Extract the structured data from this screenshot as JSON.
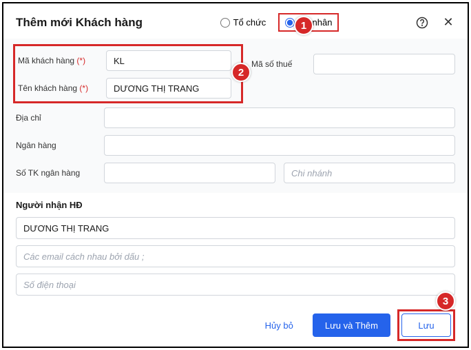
{
  "header": {
    "title": "Thêm mới Khách hàng",
    "radio_org": "Tổ chức",
    "radio_individual": "Cá nhân"
  },
  "form": {
    "customer_code_label": "Mã khách hàng",
    "customer_code_value": "KL",
    "tax_code_label": "Mã số thuế",
    "tax_code_value": "",
    "customer_name_label": "Tên khách hàng",
    "customer_name_value": "DƯƠNG THỊ TRANG",
    "address_label": "Địa chỉ",
    "address_value": "",
    "bank_label": "Ngân hàng",
    "bank_value": "",
    "bank_account_label": "Số TK ngân hàng",
    "bank_account_value": "",
    "branch_placeholder": "Chi nhánh",
    "required_mark": "(*)"
  },
  "recipient": {
    "section_title": "Người nhận HĐ",
    "name_value": "DƯƠNG THỊ TRANG",
    "email_placeholder": "Các email cách nhau bởi dấu ;",
    "phone_placeholder": "Số điện thoại"
  },
  "footer": {
    "cancel": "Hủy bỏ",
    "save_and_add": "Lưu và Thêm",
    "save": "Lưu"
  },
  "callouts": {
    "c1": "1",
    "c2": "2",
    "c3": "3"
  }
}
